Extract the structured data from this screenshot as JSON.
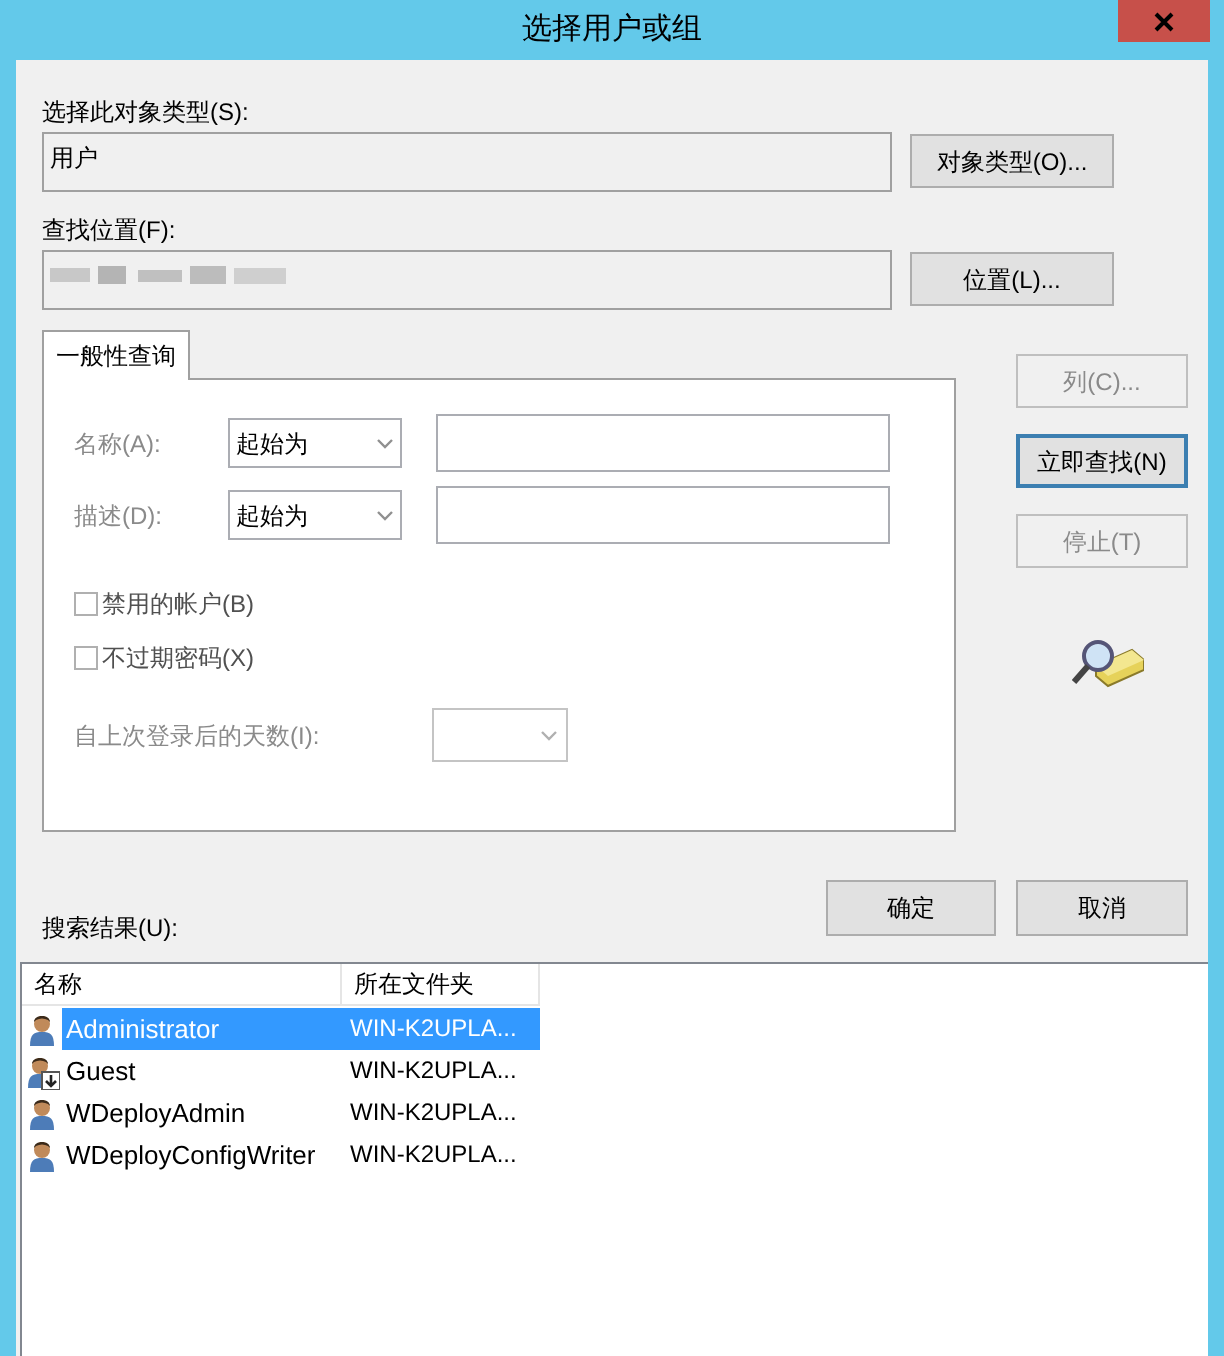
{
  "window": {
    "title": "选择用户或组"
  },
  "object_type": {
    "label": "选择此对象类型(S):",
    "value": "用户",
    "button": "对象类型(O)..."
  },
  "location": {
    "label": "查找位置(F):",
    "button": "位置(L)..."
  },
  "tabs": [
    {
      "label": "一般性查询",
      "selected": true
    }
  ],
  "query": {
    "rows": [
      {
        "label": "名称(A):",
        "condition": "起始为"
      },
      {
        "label": "描述(D):",
        "condition": "起始为"
      }
    ],
    "checkboxes": [
      {
        "label": "禁用的帐户(B)",
        "checked": false
      },
      {
        "label": "不过期密码(X)",
        "checked": false
      }
    ],
    "days_label": "自上次登录后的天数(I):"
  },
  "side_buttons": [
    {
      "label": "列(C)...",
      "disabled": true,
      "focused": false
    },
    {
      "label": "立即查找(N)",
      "disabled": false,
      "focused": true
    },
    {
      "label": "停止(T)",
      "disabled": true,
      "focused": false
    }
  ],
  "ok_button": "确定",
  "cancel_button": "取消",
  "results": {
    "label": "搜索结果(U):",
    "columns": [
      "名称",
      "所在文件夹"
    ],
    "rows": [
      {
        "name": "Administrator",
        "folder": "WIN-K2UPLA...",
        "kind": "user",
        "selected": true
      },
      {
        "name": "Guest",
        "folder": "WIN-K2UPLA...",
        "kind": "guest",
        "selected": false
      },
      {
        "name": "WDeployAdmin",
        "folder": "WIN-K2UPLA...",
        "kind": "user",
        "selected": false
      },
      {
        "name": "WDeployConfigWriter",
        "folder": "WIN-K2UPLA...",
        "kind": "user",
        "selected": false
      }
    ]
  }
}
